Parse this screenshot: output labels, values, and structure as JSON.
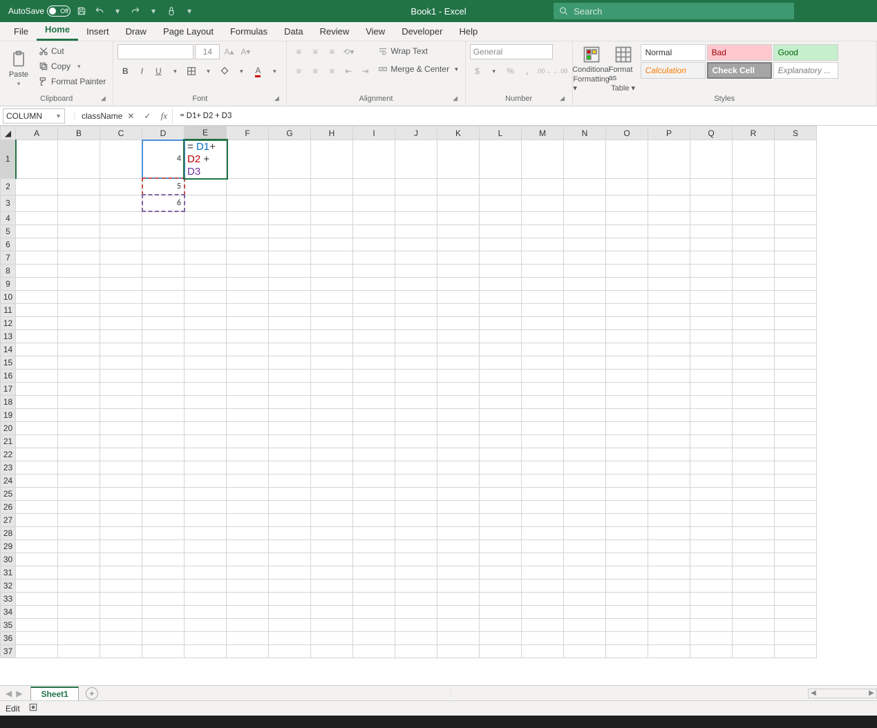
{
  "titlebar": {
    "autosave_label": "AutoSave",
    "autosave_state": "Off",
    "title": "Book1  -  Excel",
    "search_placeholder": "Search"
  },
  "tabs": [
    "File",
    "Home",
    "Insert",
    "Draw",
    "Page Layout",
    "Formulas",
    "Data",
    "Review",
    "View",
    "Developer",
    "Help"
  ],
  "active_tab": "Home",
  "ribbon": {
    "clipboard": {
      "paste": "Paste",
      "cut": "Cut",
      "copy": "Copy",
      "format_painter": "Format Painter",
      "label": "Clipboard"
    },
    "font": {
      "name": "",
      "size": "14",
      "label": "Font"
    },
    "alignment": {
      "wrap": "Wrap Text",
      "merge": "Merge & Center",
      "label": "Alignment"
    },
    "number": {
      "format": "General",
      "label": "Number"
    },
    "styles": {
      "cond": "Conditional Formatting",
      "cond1": "Conditional",
      "cond2": "Formatting",
      "fat": "Format as",
      "fat2": "Table",
      "normal": "Normal",
      "bad": "Bad",
      "good": "Good",
      "calc": "Calculation",
      "check": "Check Cell",
      "explan": "Explanatory ...",
      "label": "Styles"
    }
  },
  "formula_bar": {
    "name_box": "COLUMN",
    "formula_plain": "= D1+ D2 + D3",
    "formula_tokens": [
      "= ",
      "D1",
      "+ ",
      "D2",
      " + ",
      "D3"
    ]
  },
  "columns": [
    "A",
    "B",
    "C",
    "D",
    "E",
    "F",
    "G",
    "H",
    "I",
    "J",
    "K",
    "L",
    "M",
    "N",
    "O",
    "P",
    "Q",
    "R",
    "S"
  ],
  "row_count": 37,
  "cells": {
    "D1": "4",
    "D2": "5",
    "D3": "6"
  },
  "editing_cell": "E1",
  "editing_tokens": [
    "= ",
    "D1",
    "+ ",
    "D2",
    " + ",
    "D3"
  ],
  "active_col": "E",
  "active_row": 1,
  "sheet": {
    "name": "Sheet1"
  },
  "statusbar": {
    "mode": "Edit"
  }
}
